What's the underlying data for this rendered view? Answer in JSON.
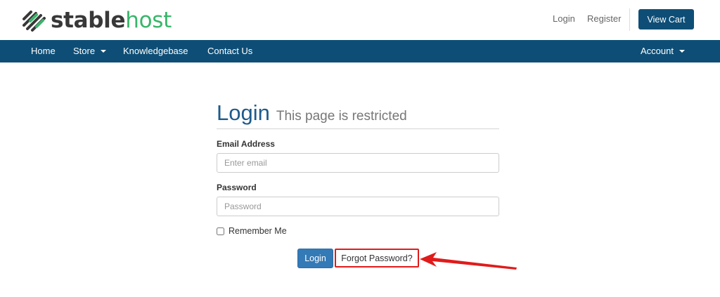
{
  "brand": {
    "part1": "stable",
    "part2": "host",
    "accent_color": "#39b56a",
    "icon": "stripes-logo-icon"
  },
  "header": {
    "login_label": "Login",
    "register_label": "Register",
    "view_cart_label": "View Cart"
  },
  "nav": {
    "items": [
      {
        "label": "Home"
      },
      {
        "label": "Store"
      },
      {
        "label": "Knowledgebase"
      },
      {
        "label": "Contact Us"
      }
    ],
    "account_label": "Account",
    "bar_color": "#0e4e76"
  },
  "login": {
    "title": "Login",
    "subtitle": "This page is restricted",
    "email_label": "Email Address",
    "email_placeholder": "Enter email",
    "password_label": "Password",
    "password_placeholder": "Password",
    "remember_label": "Remember Me",
    "submit_label": "Login",
    "forgot_label": "Forgot Password?",
    "highlight_color": "#e01b1b"
  }
}
